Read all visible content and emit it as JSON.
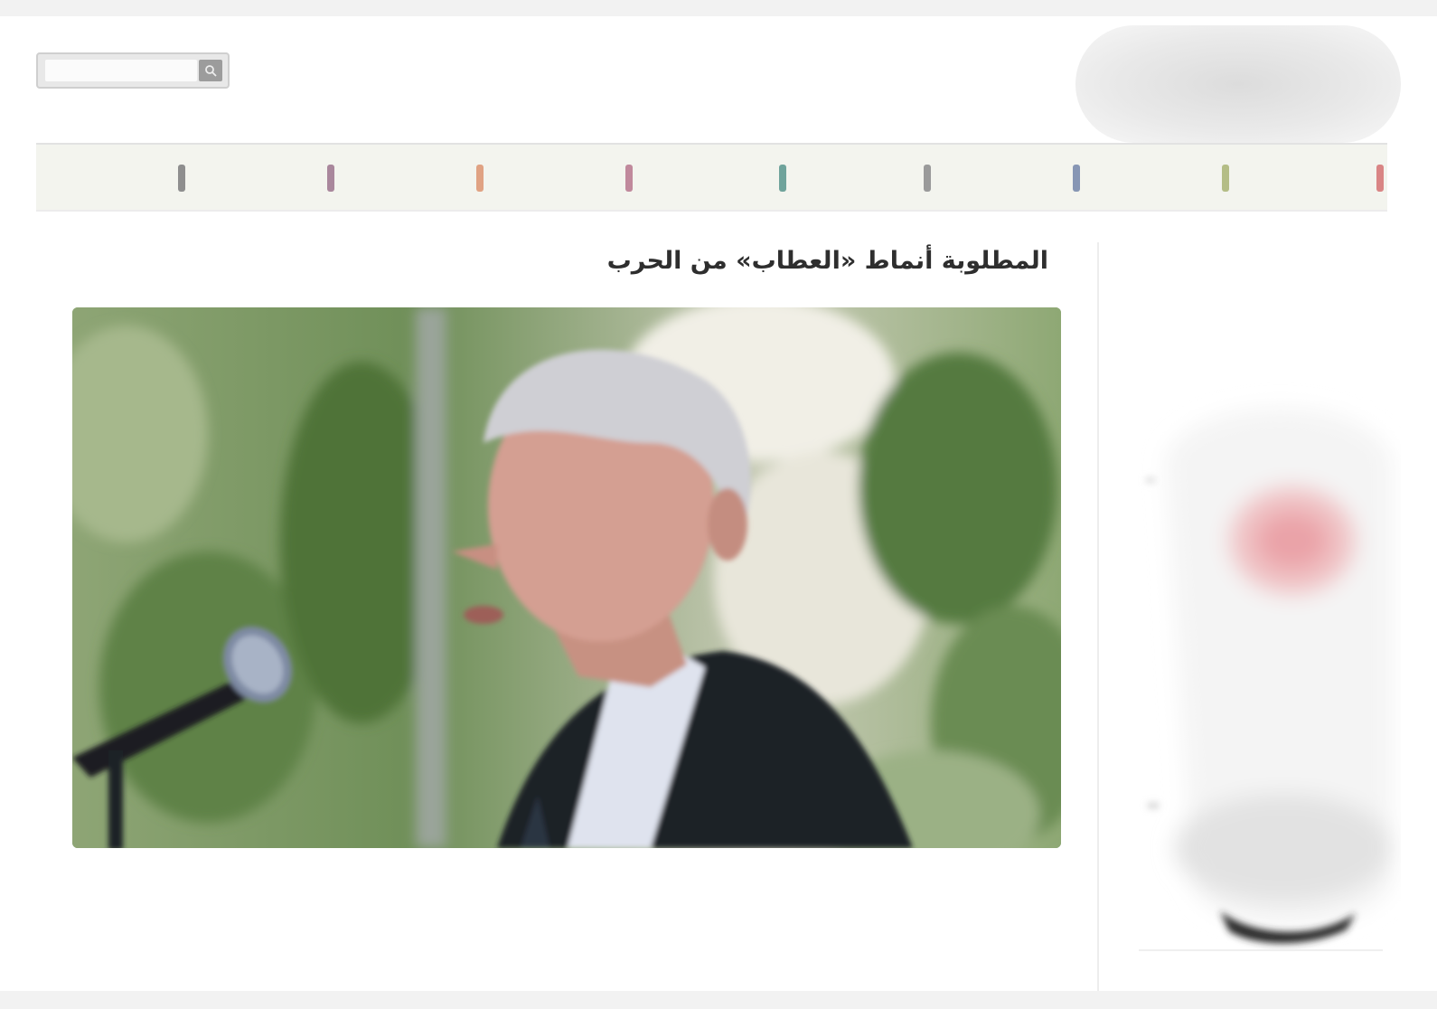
{
  "search": {
    "placeholder": ""
  },
  "nav": {
    "items": [
      {
        "label": "",
        "color": "#d98585"
      },
      {
        "label": "",
        "color": "#b4bd86"
      },
      {
        "label": "",
        "color": "#8796b4"
      },
      {
        "label": "",
        "color": "#9a9a9a"
      },
      {
        "label": "",
        "color": "#6fa39b"
      },
      {
        "label": "",
        "color": "#c0899c"
      },
      {
        "label": "",
        "color": "#e0a283"
      },
      {
        "label": "",
        "color": "#a9879c"
      },
      {
        "label": "",
        "color": "#8e8e8e"
      }
    ]
  },
  "article": {
    "headline": "المطلوبة أنماط «العطاب» من الحرب"
  },
  "colors": {
    "background": "#f2f2f2",
    "nav_background": "#f3f4ee",
    "headline": "#2e2e2e"
  }
}
